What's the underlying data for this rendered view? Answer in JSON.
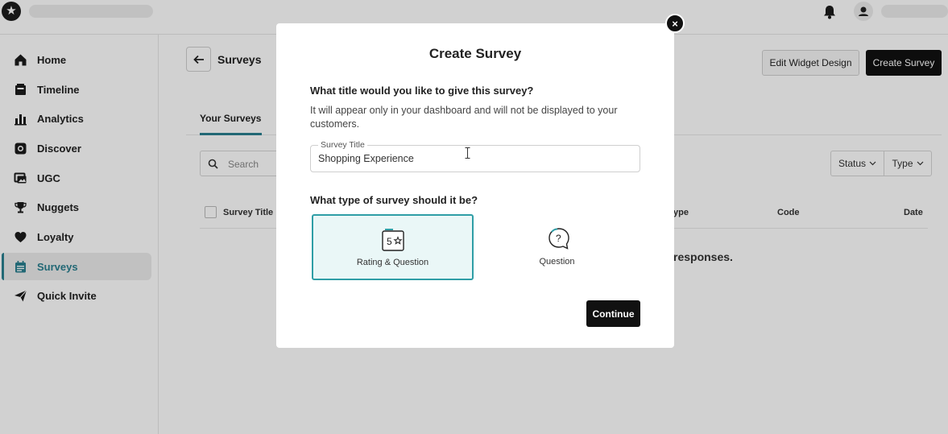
{
  "sidebar": {
    "items": [
      {
        "label": "Home",
        "icon": "home-icon"
      },
      {
        "label": "Timeline",
        "icon": "timeline-icon"
      },
      {
        "label": "Analytics",
        "icon": "bar-chart-icon"
      },
      {
        "label": "Discover",
        "icon": "discover-icon"
      },
      {
        "label": "UGC",
        "icon": "gallery-icon"
      },
      {
        "label": "Nuggets",
        "icon": "trophy-icon"
      },
      {
        "label": "Loyalty",
        "icon": "heart-icon"
      },
      {
        "label": "Surveys",
        "icon": "calendar-icon",
        "active": true
      },
      {
        "label": "Quick Invite",
        "icon": "send-icon"
      }
    ]
  },
  "page": {
    "title": "Surveys",
    "edit_widget_label": "Edit Widget Design",
    "create_survey_label": "Create Survey",
    "tab_label": "Your Surveys",
    "search_placeholder": "Search",
    "status_filter": "Status",
    "type_filter": "Type",
    "columns": [
      "Survey Title",
      "ype",
      "Code",
      "Date"
    ],
    "empty_message": "responses."
  },
  "modal": {
    "title": "Create Survey",
    "question_title": "What title would you like to give this survey?",
    "hint": "It will appear only in your dashboard and will not be displayed to your customers.",
    "field_label": "Survey Title",
    "field_value": "Shopping Experience",
    "question_type": "What type of survey should it be?",
    "options": [
      {
        "label": "Rating & Question",
        "icon_text": "5",
        "selected": true
      },
      {
        "label": "Question",
        "icon_text": "?",
        "selected": false
      }
    ],
    "continue_label": "Continue"
  },
  "colors": {
    "accent": "#2a7f8f",
    "selected_border": "#2f9ea6",
    "selected_bg": "#eaf7f7",
    "primary_button": "#111111"
  }
}
